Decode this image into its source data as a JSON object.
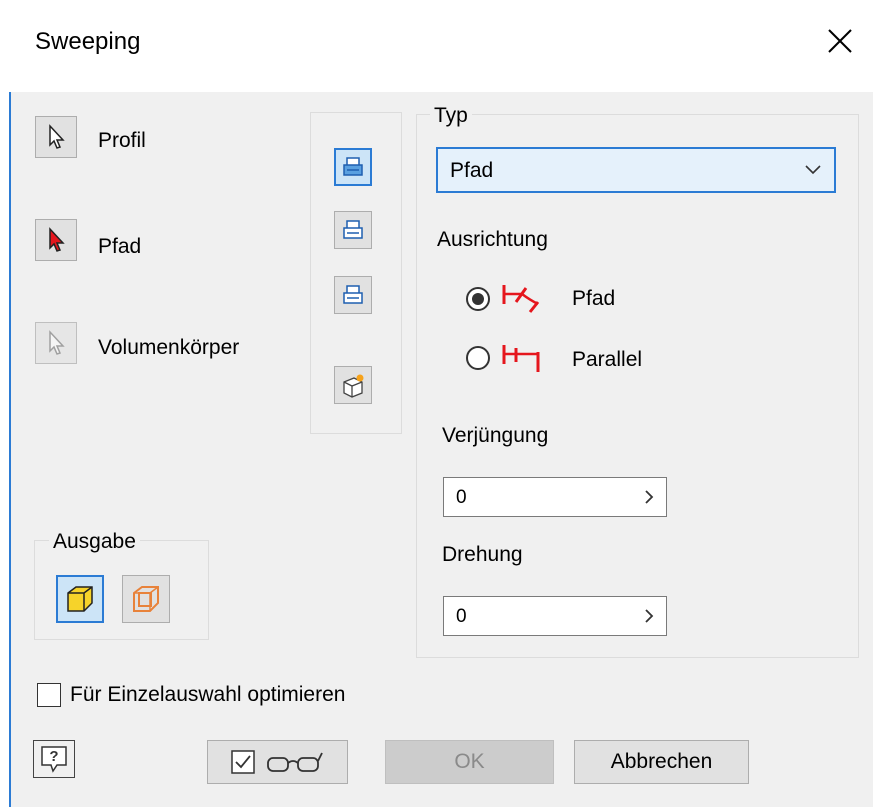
{
  "window": {
    "title": "Sweeping"
  },
  "selection": {
    "profile_label": "Profil",
    "path_label": "Pfad",
    "solid_label": "Volumenkörper"
  },
  "type_group": {
    "legend": "Typ",
    "selected": "Pfad"
  },
  "orientation": {
    "label": "Ausrichtung",
    "options": [
      {
        "label": "Pfad",
        "selected": true
      },
      {
        "label": "Parallel",
        "selected": false
      }
    ]
  },
  "taper": {
    "label": "Verjüngung",
    "value": "0"
  },
  "twist": {
    "label": "Drehung",
    "value": "0"
  },
  "output": {
    "legend": "Ausgabe",
    "selected": "solid"
  },
  "optimize": {
    "label": "Für Einzelauswahl optimieren",
    "checked": false
  },
  "footer": {
    "preview_checked": true,
    "ok_label": "OK",
    "cancel_label": "Abbrechen"
  },
  "colors": {
    "accent": "#2b7bd4",
    "icon_red": "#e5161d",
    "solid_yellow": "#f6d32a",
    "surface_orange": "#e8823a"
  }
}
